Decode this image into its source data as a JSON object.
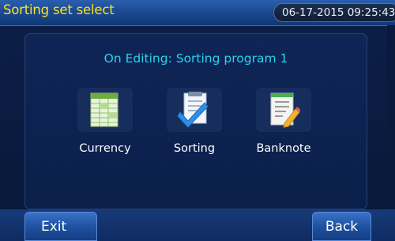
{
  "header": {
    "title": "Sorting set select",
    "datetime": "06-17-2015 09:25:43"
  },
  "panel": {
    "title": "On Editing: Sorting program 1",
    "options": [
      {
        "label": "Currency",
        "icon": "spreadsheet-icon"
      },
      {
        "label": "Sorting",
        "icon": "checklist-icon"
      },
      {
        "label": "Banknote",
        "icon": "document-edit-icon"
      }
    ]
  },
  "footer": {
    "exit_label": "Exit",
    "back_label": "Back"
  },
  "colors": {
    "title_yellow": "#ffe21a",
    "accent_cyan": "#27d3ee",
    "panel_bg": "#0f2556",
    "header_blue": "#1b4a92"
  }
}
